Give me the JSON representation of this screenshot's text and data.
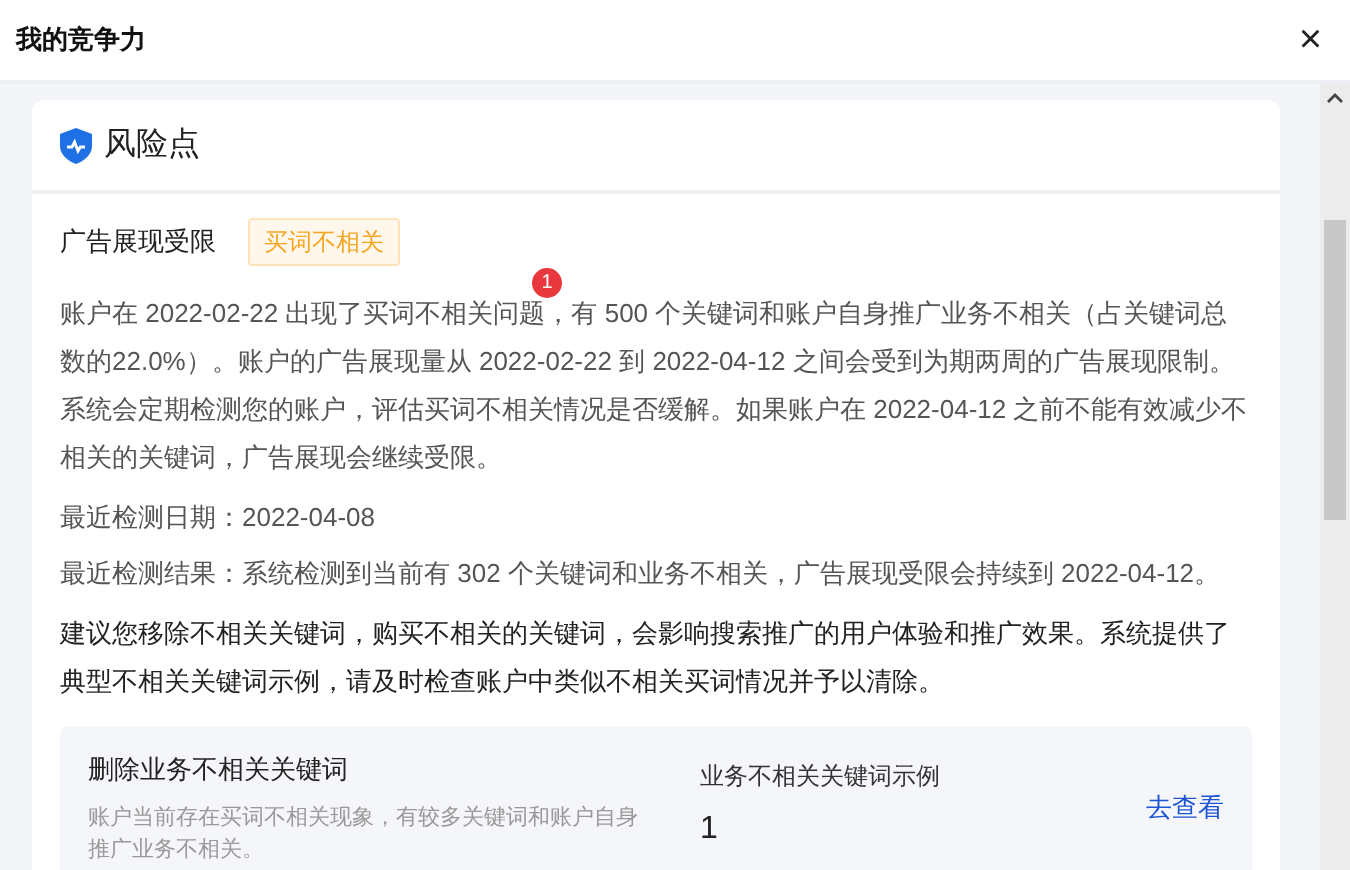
{
  "window": {
    "title": "我的竞争力",
    "close": "×"
  },
  "card": {
    "title": "风险点",
    "issue": {
      "title": "广告展现受限",
      "tag": "买词不相关"
    },
    "description": "账户在 2022-02-22 出现了买词不相关问题，有 500 个关键词和账户自身推广业务不相关（占关键词总数的22.0%）。账户的广告展现量从 2022-02-22 到 2022-04-12 之间会受到为期两周的广告展现限制。系统会定期检测您的账户，评估买词不相关情况是否缓解。如果账户在 2022-04-12 之前不能有效减少不相关的关键词，广告展现会继续受限。",
    "badge": "1",
    "facts": [
      {
        "label": "最近检测日期：",
        "value": "2022-04-08"
      },
      {
        "label": "最近检测结果：",
        "value": "系统检测到当前有 302 个关键词和业务不相关，广告展现受限会持续到 2022-04-12。"
      }
    ],
    "suggestion": "建议您移除不相关关键词，购买不相关的关键词，会影响搜索推广的用户体验和推广效果。系统提供了典型不相关关键词示例，请及时检查账户中类似不相关买词情况并予以清除。",
    "action": {
      "title": "删除业务不相关关键词",
      "description": "账户当前存在买词不相关现象，有较多关键词和账户自身推广业务不相关。",
      "metric_label": "业务不相关关键词示例",
      "metric_value": "1",
      "link": "去查看"
    }
  }
}
